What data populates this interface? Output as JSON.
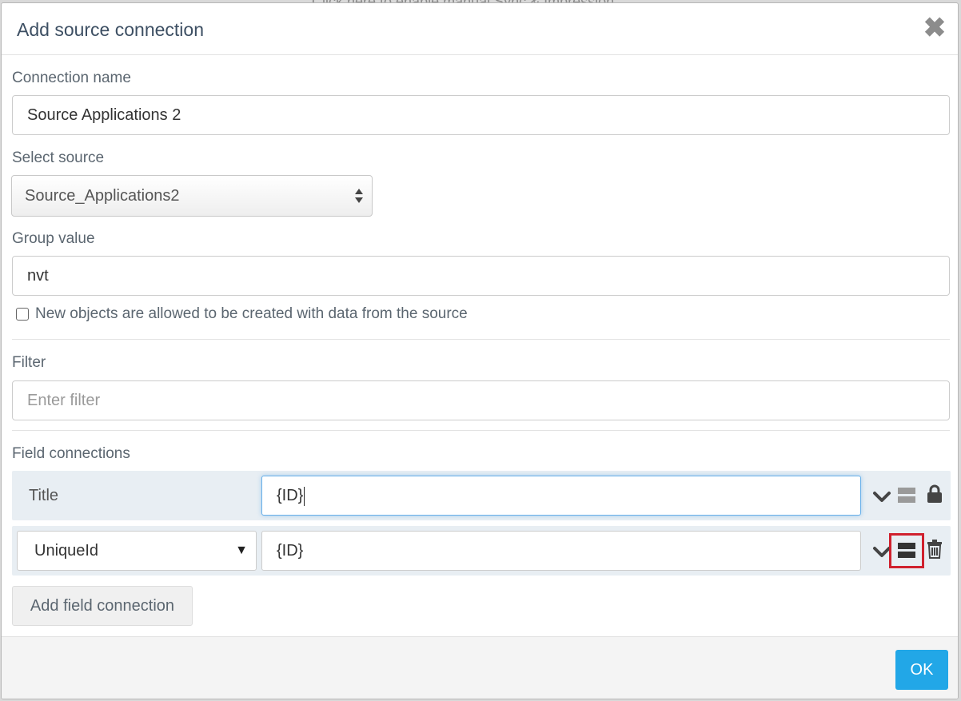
{
  "backdrop": {
    "text": "Click here to enable manual Sync & Impression"
  },
  "dialog": {
    "title": "Add source connection"
  },
  "form": {
    "connection_name": {
      "label": "Connection name",
      "value": "Source Applications 2"
    },
    "source": {
      "label": "Select source",
      "selected": "Source_Applications2"
    },
    "group": {
      "label": "Group value",
      "value": "nvt"
    },
    "allow_new": {
      "label": "New objects are allowed to be created with data from the source",
      "checked": false
    },
    "filter": {
      "label": "Filter",
      "placeholder": "Enter filter",
      "value": ""
    },
    "field_connections": {
      "label": "Field connections",
      "rows": [
        {
          "field": "Title",
          "value": "{ID}",
          "locked": true
        },
        {
          "field": "UniqueId",
          "value": "{ID}",
          "locked": false
        }
      ],
      "add_label": "Add field connection"
    }
  },
  "footer": {
    "ok_label": "OK"
  },
  "colors": {
    "accent": "#22a7e7",
    "row_bg": "#e8eef3",
    "highlight": "#d0212e"
  }
}
